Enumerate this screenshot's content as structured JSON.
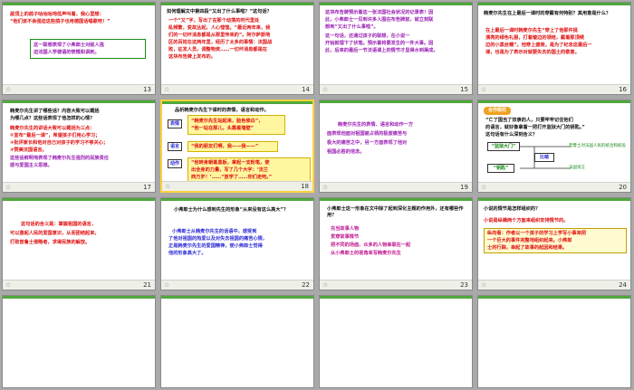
{
  "slides": [
    {
      "num": "13",
      "lines": [
        "屋顶上的鸽子咕咕咕地低声叫着，我心里想：",
        "“他们该不会强迫这些鸽子也用德国话唱歌吧！”"
      ],
      "box": [
        "这一联想表现了小弗郎士对敌人强",
        "迫法国人学德语的愤慨和讽刺。"
      ]
    },
    {
      "num": "14",
      "title": "如何理解文中第四段“又出了什么事啦？”这句话？",
      "lines": [
        "一个“又”字，写出了在那个动荡的时代里处",
        "乱频繁，变故丛起，人心惶惶。“最近两年来，我",
        "们的一切坏消息都是从那里传来的”。阿尔萨斯地",
        "区的百姓在这两年里，经历了太多的事情：法国战",
        "败，征发人员，调整物资……一切坏消息都是在",
        "这块布告牌上发布的。"
      ]
    },
    {
      "num": "15",
      "lines": [
        "这块布告牌预示着这一张法国社会状况的记录表！因",
        "此，小弗郎士一见到许多人围在布告牌前，就立刻联",
        "想到“又出了什么事啦”。",
        "    这一句话，还通过孩子的联想，在小说一",
        "开始就埋下了伏笔。预示着将要发生的一件大事。因",
        "此，后来的最后一节法语课上的情节才显得水到渠成。"
      ]
    },
    {
      "num": "16",
      "title": "韩麦尔先生在上最后一课时的穿戴有何特别？其用意是什么？",
      "lines": [
        "在上最后一课时韩麦尔先生“穿上了他那件挺",
        "漂亮的绿色礼服，打着皱边的领结，戴着那顶绣",
        "边的小黑丝帽”。他穿上盛装，是为了纪念这最后一",
        "课，也是为了表示对就要失去的国土的敬意。"
      ]
    },
    {
      "num": "17",
      "title": [
        "韩麦尔先生讲了哪些话？内容大致可以概括",
        "为哪几点？这些话表现了他怎样的心情？"
      ],
      "lines": [
        "韩麦尔先生的讲话大致可以概括为三点：",
        "①宣布“最后一课”，希望孩子们用心学习；",
        "②批评家长和他对自己对孩子的学习不够关心；",
        "③赞美法国语言。",
        "这些话鲜明地表现了韩麦尔先生强烈的民族责任",
        "感与爱国主义思想。"
      ]
    },
    {
      "num": "18",
      "title": "品析韩麦尔先生下课时的表情，语言和动作。",
      "labels": [
        "表情",
        "语言",
        "动作"
      ],
      "q1": [
        "“韩麦尔先生站起来，脸色惨白”，",
        "“他一站在那儿，头靠着墙壁”"
      ],
      "q2": [
        "“我的朋友们啊，我——我——”"
      ],
      "q3": [
        "“他转身朝着黑板，拿起一支粉笔，使",
        "出全身的力量，写了几个大字：‘法兰",
        "西万岁！’……“放学了……你们走吧。”"
      ]
    },
    {
      "num": "19",
      "lines": [
        "韩麦尔先生的表情、语言和动作一方",
        "面表现他面对祖国被占领的极度痛苦与",
        "极大的痛苦之中，另一方面表现了他对",
        "祖国必胜的信念。"
      ]
    },
    {
      "num": "20",
      "badge": "合作探究",
      "lines": [
        "“亡了国当了奴隶的人，只要牢牢记住他们",
        "的语言，就好像拿着一把打开监狱大门的钥匙。”",
        "这句话有什么深刻含义？"
      ],
      "k1": "“监狱大门”",
      "k2": "比喻",
      "k3": "“钥匙”",
      "r1": "普鲁士对法国人民的统治和奴役",
      "r3": "法国语言"
    },
    {
      "num": "21",
      "lines": [
        "这句话的含义是：掌握祖国的语言，",
        "可以激起人民的爱国意识，从而团结起来，",
        "打败普鲁士侵略者，求得民族的解放。"
      ]
    },
    {
      "num": "22",
      "title": "小弗郎士为什么感到先生的形象“从来没有这么高大”？",
      "lines": [
        "小弗郎士从韩麦尔先生的话语中，感受到",
        "了他对祖国的热爱以及对失去祖国的痛苦心情，",
        "正是韩麦尔先生的爱国精神，使小弗郎士觉得",
        "他的形象高大了。"
      ]
    },
    {
      "num": "23",
      "title": "小弗郎士这一形象在文中除了起到深化主题的作用外，还有哪些作用？",
      "lines": [
        "充当故事人物",
        "贯穿故事情节",
        "把不同的场面、众多的人物串联在一起",
        "从小弗郎士的视角来写韩麦尔先生"
      ]
    },
    {
      "num": "24",
      "title": "小说的情节是怎样组织的？",
      "lead": "小说是纵横两个方面来组织安排情节的。",
      "box": [
        "纵向看：作者以一个孩子的学习上学写小事来把",
        "一个巨大的事件完整地组织起来。小弗郎",
        "士的行踪，串起了故事的起因和结果。"
      ],
      "box_label": "纵向看："
    }
  ]
}
